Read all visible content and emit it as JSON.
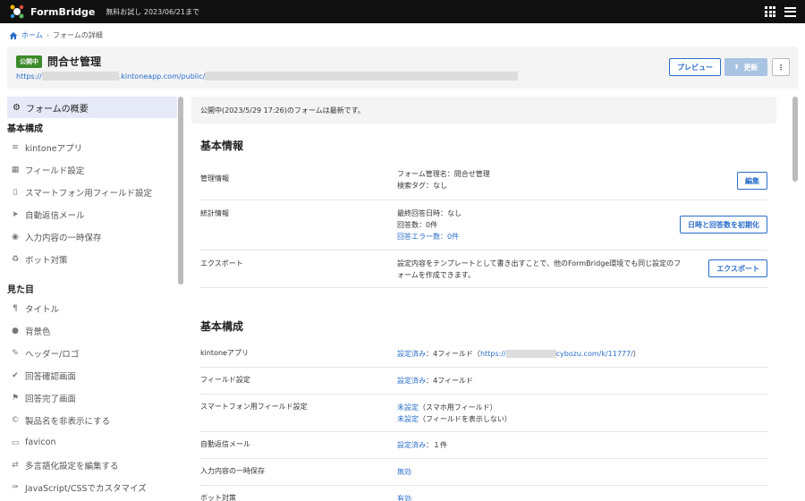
{
  "topbar": {
    "brand": "FormBridge",
    "trial": "無料お試し 2023/06/21まで"
  },
  "breadcrumb": {
    "home": "ホーム",
    "separator": "›",
    "current": "フォームの詳細"
  },
  "header": {
    "badge": "公開中",
    "title": "問合せ管理",
    "url_prefix": "https://",
    "url_middle": ".kintoneapp.com/public/",
    "preview_label": "プレビュー",
    "update_label": "更新",
    "more_label": "⋮"
  },
  "sidebar": {
    "active": "フォームの概要",
    "section1": "基本構成",
    "items1": [
      {
        "label": "kintoneアプリ",
        "icon": "database-icon"
      },
      {
        "label": "フィールド設定",
        "icon": "grid-icon"
      },
      {
        "label": "スマートフォン用フィールド設定",
        "icon": "smartphone-icon"
      },
      {
        "label": "自動返信メール",
        "icon": "send-icon"
      },
      {
        "label": "入力内容の一時保存",
        "icon": "save-icon"
      },
      {
        "label": "ボット対策",
        "icon": "recycle-icon"
      }
    ],
    "section2": "見た目",
    "items2": [
      {
        "label": "タイトル",
        "icon": "pilcrow-icon"
      },
      {
        "label": "背景色",
        "icon": "droplet-icon"
      },
      {
        "label": "ヘッダー/ロゴ",
        "icon": "pen-icon"
      },
      {
        "label": "回答確認画面",
        "icon": "check-icon"
      },
      {
        "label": "回答完了画面",
        "icon": "flag-icon"
      },
      {
        "label": "製品名を非表示にする",
        "icon": "copyright-icon"
      },
      {
        "label": "favicon",
        "icon": "bookmark-icon"
      },
      {
        "label": "多言語化設定を編集する",
        "icon": "language-icon"
      },
      {
        "label": "JavaScript/CSSでカスタマイズ",
        "icon": "wrench-icon"
      }
    ]
  },
  "main": {
    "notice": "公開中(2023/5/29 17:26)のフォームは最新です。",
    "section_basic": "基本情報",
    "manage_label": "管理情報",
    "manage_line1": "フォーム管理名：問合せ管理",
    "manage_line2": "検索タグ：なし",
    "edit_button": "編集",
    "stats_label": "統計情報",
    "stats_line1": "最終回答日時：なし",
    "stats_line2": "回答数：0件",
    "stats_line3": "回答エラー数：0件",
    "reset_button": "日時と回答数を初期化",
    "export_label": "エクスポート",
    "export_line1": "設定内容をテンプレートとして書き出すことで、他のFormBridge環境でも同じ設定のフ",
    "export_line2": "ォームを作成できます。",
    "export_button": "エクスポート",
    "section_config": "基本構成",
    "config_rows": [
      {
        "label": "kintoneアプリ",
        "status": "設定済み",
        "detail": "：4フィールド（",
        "link": "https://",
        "link_end": "cybozu.com/k/11777/",
        "close": "）"
      },
      {
        "label": "フィールド設定",
        "status": "設定済み",
        "detail": "：4フィールド"
      },
      {
        "label": "スマートフォン用フィールド設定",
        "status": "未設定",
        "detail": "（スマホ用フィールド）",
        "status2": "未設定",
        "detail2": "（フィールドを表示しない）"
      },
      {
        "label": "自動返信メール",
        "status": "設定済み",
        "detail": "：１件"
      },
      {
        "label": "入力内容の一時保存",
        "status": "無効",
        "detail": ""
      },
      {
        "label": "ボット対策",
        "status": "有効",
        "detail": ""
      }
    ]
  }
}
